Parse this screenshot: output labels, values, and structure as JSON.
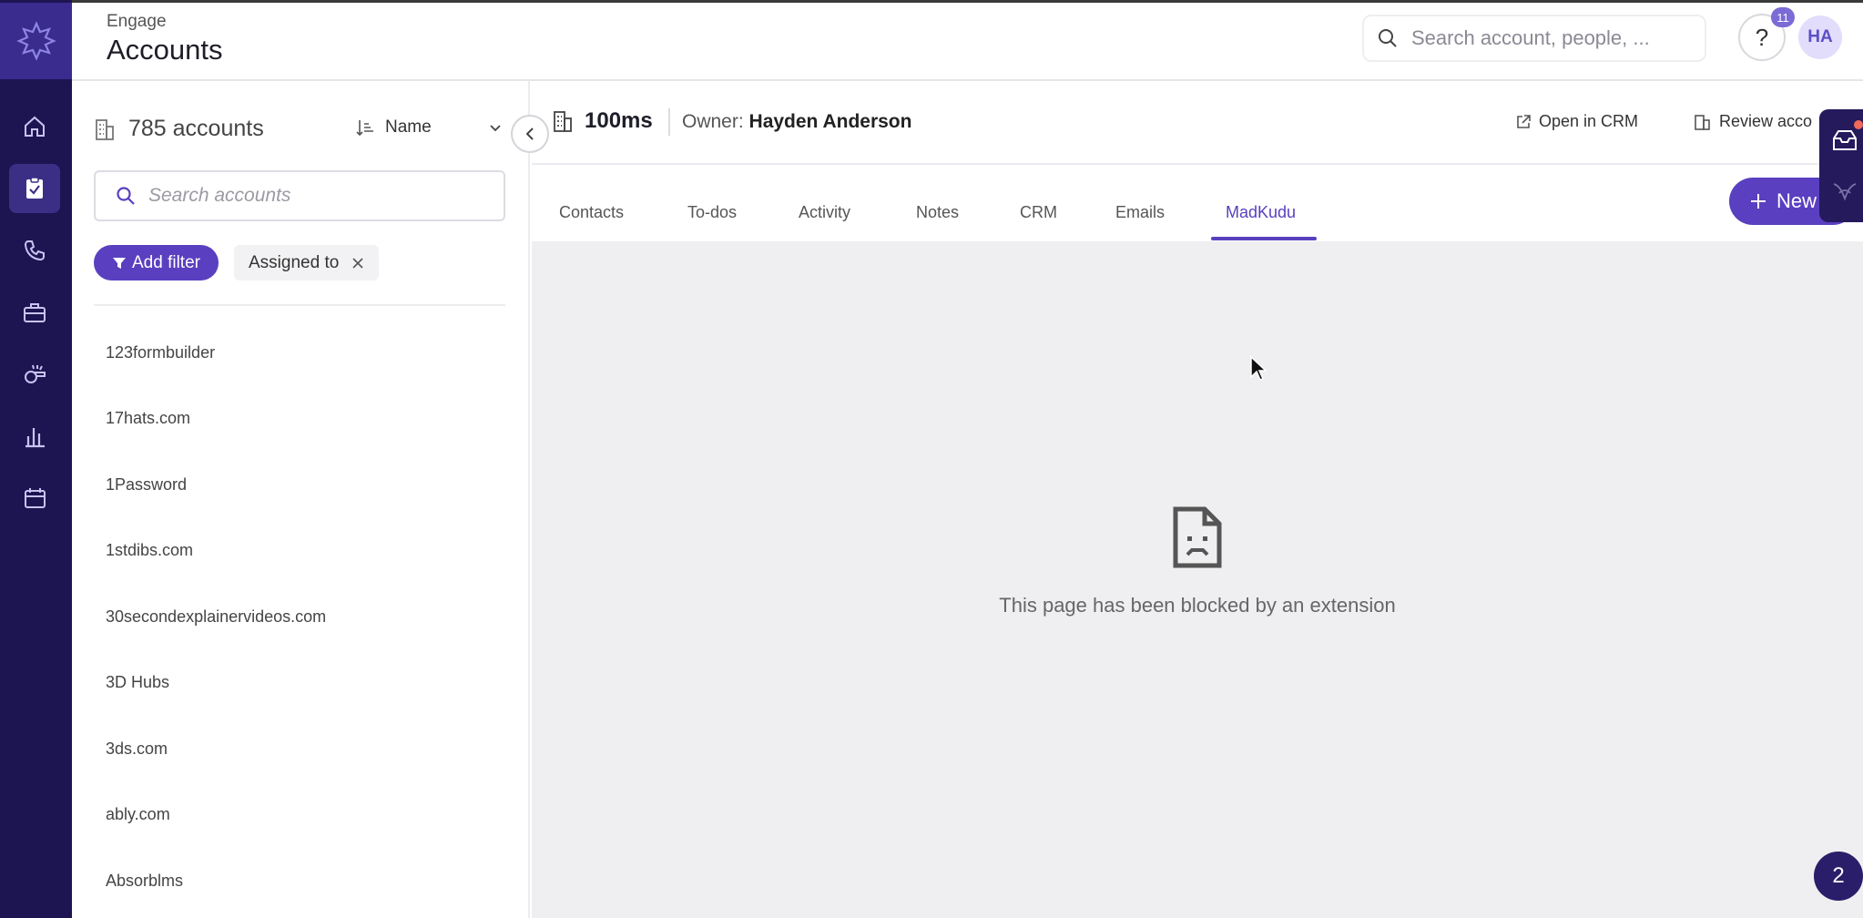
{
  "app": {
    "breadcrumb": "Engage",
    "title": "Accounts"
  },
  "global_search": {
    "placeholder": "Search account, people, ..."
  },
  "header": {
    "help_label": "?",
    "notification_count": "11",
    "avatar_initials": "HA"
  },
  "nav": {
    "items": [
      "home-icon",
      "todo-clipboard-icon",
      "phone-icon",
      "briefcase-icon",
      "whistle-icon",
      "bar-chart-icon",
      "calendar-icon"
    ],
    "active": "todo-clipboard-icon"
  },
  "accounts_panel": {
    "count_label": "785 accounts",
    "sort_label": "Name",
    "search_placeholder": "Search accounts",
    "add_filter_label": "Add filter",
    "filter_chip_label": "Assigned to",
    "accounts": [
      "123formbuilder",
      "17hats.com",
      "1Password",
      "1stdibs.com",
      "30secondexplainervideos.com",
      "3D Hubs",
      "3ds.com",
      "ably.com",
      "Absorblms"
    ]
  },
  "detail": {
    "account_name": "100ms",
    "owner_prefix": "Owner:",
    "owner_name": "Hayden Anderson",
    "open_crm_label": "Open in CRM",
    "review_label": "Review acco",
    "new_button_label": "New",
    "tabs": [
      "Contacts",
      "To-dos",
      "Activity",
      "Notes",
      "CRM",
      "Emails",
      "MadKudu"
    ],
    "active_tab": "MadKudu",
    "blocked_message": "This page has been blocked by an extension"
  },
  "chat_widget": {
    "count": "2"
  },
  "colors": {
    "nav_bg": "#1d1452",
    "accent": "#5a3fc0",
    "content_bg": "#efeff1"
  }
}
